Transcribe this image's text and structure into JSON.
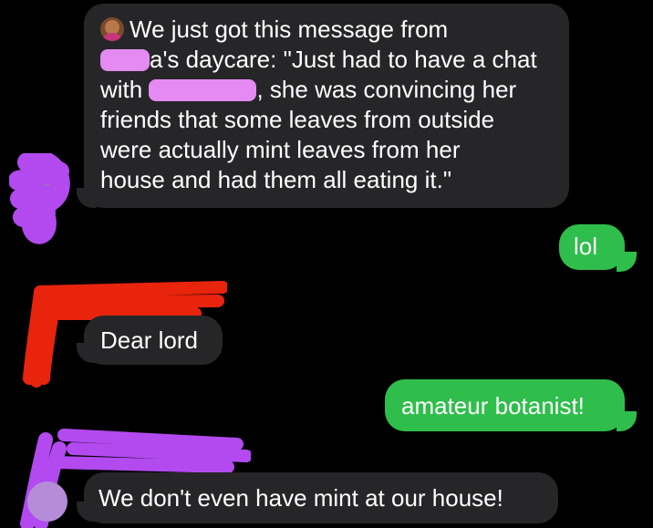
{
  "messages": {
    "m1": {
      "line1": "We just got this message from",
      "line2_suffix": "a's daycare: \"Just had to have a chat",
      "line3_prefix": "with",
      "line3_suffix": ", she was convincing her",
      "line4": "friends that some leaves from outside",
      "line5": "were actually mint leaves from her",
      "line6": "house and had them all eating it.\""
    },
    "m2": {
      "text": "lol"
    },
    "m3": {
      "text": "Dear lord"
    },
    "m4": {
      "text": "amateur botanist!"
    },
    "m5": {
      "text": "We don't even have mint at our house!"
    }
  },
  "colors": {
    "received_bubble": "#262628",
    "sent_bubble": "#2fbe4b",
    "redaction_pink": "#e58af2",
    "redaction_purple": "#b24af0",
    "redaction_red": "#e8240c"
  },
  "icons": {
    "sender_emoji": "woman-tipping-hand-emoji"
  }
}
